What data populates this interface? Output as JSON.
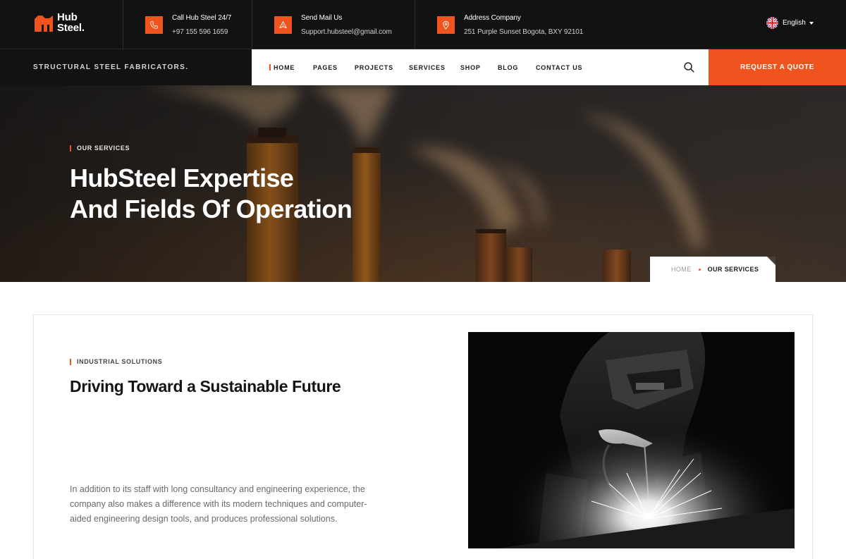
{
  "brand": {
    "line1": "Hub",
    "line2": "Steel.",
    "logo_icon": "factory-logo-icon",
    "accent_color": "#f0541e"
  },
  "topbar": {
    "contacts": [
      {
        "icon": "phone-icon",
        "label": "Call Hub Steel 24/7",
        "value": "+97 155 596 1659"
      },
      {
        "icon": "send-mail-icon",
        "label": "Send Mail Us",
        "value": "Support.hubsteel@gmail.com"
      },
      {
        "icon": "location-pin-icon",
        "label": "Address Company",
        "value": "251 Purple Sunset Bogota, BXY 92101"
      }
    ],
    "language": {
      "icon": "uk-flag-icon",
      "label": "English"
    }
  },
  "tagline": "STRUCTURAL STEEL FABRICATORS.",
  "nav": {
    "items": [
      "HOME",
      "PAGES",
      "PROJECTS",
      "SERVICES",
      "SHOP",
      "BLOG",
      "CONTACT US"
    ],
    "active": "HOME",
    "search_icon": "search-icon",
    "cta": "REQUEST A QUOTE"
  },
  "hero": {
    "eyebrow": "OUR SERVICES",
    "title_line1": "HubSteel Expertise",
    "title_line2": "And Fields Of Operation",
    "breadcrumb": {
      "home": "HOME",
      "current": "OUR SERVICES"
    }
  },
  "section": {
    "eyebrow": "INDUSTRIAL SOLUTIONS",
    "title": "Driving Toward a Sustainable Future",
    "text": "In addition to its staff with long consultancy and engineering experience, the company also makes a difference with its modern techniques and computer-aided engineering design tools, and produces professional solutions."
  }
}
